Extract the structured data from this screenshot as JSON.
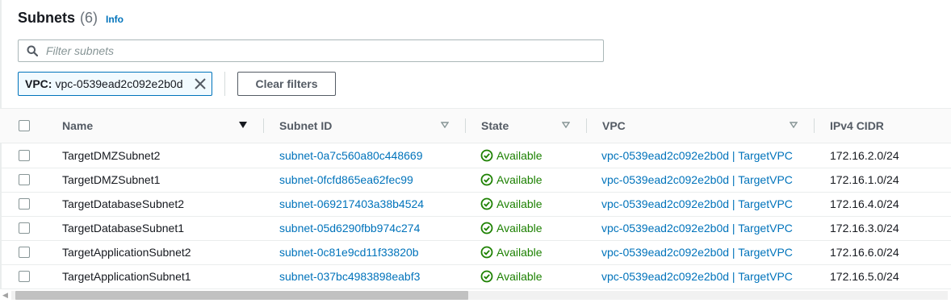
{
  "header": {
    "title": "Subnets",
    "count": "(6)",
    "info": "Info"
  },
  "search": {
    "placeholder": "Filter subnets",
    "value": ""
  },
  "filter_token": {
    "key": "VPC:",
    "value": "vpc-0539ead2c092e2b0d"
  },
  "clear_filters_label": "Clear filters",
  "table": {
    "columns": [
      "Name",
      "Subnet ID",
      "State",
      "VPC",
      "IPv4 CIDR"
    ],
    "rows": [
      {
        "name": "TargetDMZSubnet2",
        "subnet_id": "subnet-0a7c560a80c448669",
        "state": "Available",
        "vpc": "vpc-0539ead2c092e2b0d | TargetVPC",
        "cidr": "172.16.2.0/24"
      },
      {
        "name": "TargetDMZSubnet1",
        "subnet_id": "subnet-0fcfd865ea62fec99",
        "state": "Available",
        "vpc": "vpc-0539ead2c092e2b0d | TargetVPC",
        "cidr": "172.16.1.0/24"
      },
      {
        "name": "TargetDatabaseSubnet2",
        "subnet_id": "subnet-069217403a38b4524",
        "state": "Available",
        "vpc": "vpc-0539ead2c092e2b0d | TargetVPC",
        "cidr": "172.16.4.0/24"
      },
      {
        "name": "TargetDatabaseSubnet1",
        "subnet_id": "subnet-05d6290fbb974c274",
        "state": "Available",
        "vpc": "vpc-0539ead2c092e2b0d | TargetVPC",
        "cidr": "172.16.3.0/24"
      },
      {
        "name": "TargetApplicationSubnet2",
        "subnet_id": "subnet-0c81e9cd11f33820b",
        "state": "Available",
        "vpc": "vpc-0539ead2c092e2b0d | TargetVPC",
        "cidr": "172.16.6.0/24"
      },
      {
        "name": "TargetApplicationSubnet1",
        "subnet_id": "subnet-037bc4983898eabf3",
        "state": "Available",
        "vpc": "vpc-0539ead2c092e2b0d | TargetVPC",
        "cidr": "172.16.5.0/24"
      }
    ]
  },
  "colors": {
    "link": "#0073bb",
    "available": "#1d8102",
    "text": "#16191f",
    "header_text": "#545b64"
  },
  "icons": {
    "search": "search-icon",
    "remove_token": "close-icon",
    "sort": "sort-caret-icon",
    "status": "check-circle-icon"
  }
}
